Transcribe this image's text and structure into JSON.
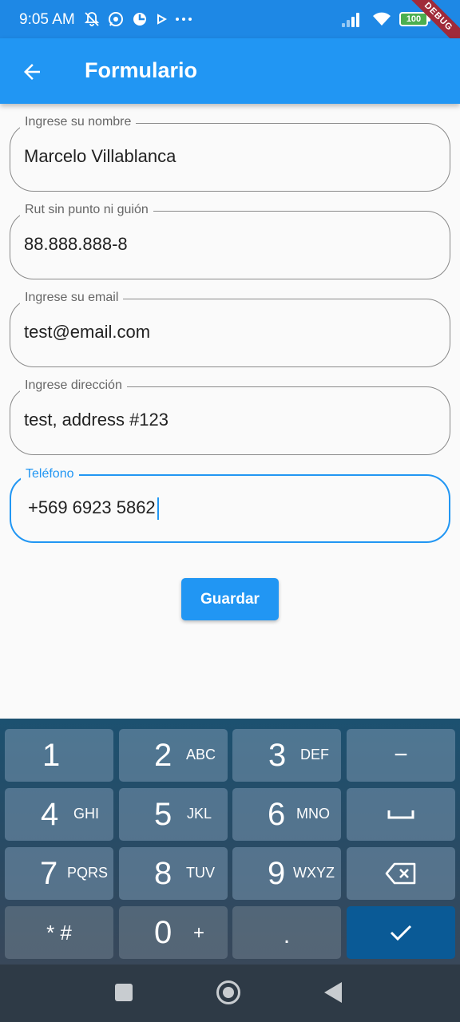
{
  "status_bar": {
    "time": "9:05 AM",
    "battery": "100",
    "debug_banner": "DEBUG",
    "left_icons": [
      "mute-icon",
      "whatsapp-icon",
      "app-icon",
      "play-icon",
      "more-icon"
    ],
    "right_icons": [
      "signal-icon",
      "wifi-icon",
      "battery-icon"
    ]
  },
  "app_bar": {
    "title": "Formulario",
    "back_icon": "arrow-back-icon"
  },
  "form": {
    "fields": [
      {
        "label": "Ingrese su nombre",
        "value": "Marcelo Villablanca"
      },
      {
        "label": "Rut sin punto ni guión",
        "value": "88.888.888-8"
      },
      {
        "label": "Ingrese su email",
        "value": "test@email.com"
      },
      {
        "label": "Ingrese dirección",
        "value": "test, address #123"
      },
      {
        "label": "Teléfono",
        "value": "+569 6923 5862"
      }
    ],
    "save_label": "Guardar"
  },
  "keyboard": {
    "rows": [
      [
        {
          "digit": "1",
          "letters": ""
        },
        {
          "digit": "2",
          "letters": "ABC"
        },
        {
          "digit": "3",
          "letters": "DEF"
        },
        {
          "symbol": "−"
        }
      ],
      [
        {
          "digit": "4",
          "letters": "GHI"
        },
        {
          "digit": "5",
          "letters": "JKL"
        },
        {
          "digit": "6",
          "letters": "MNO"
        },
        {
          "symbol": "space-icon"
        }
      ],
      [
        {
          "digit": "7",
          "letters": "PQRS"
        },
        {
          "digit": "8",
          "letters": "TUV"
        },
        {
          "digit": "9",
          "letters": "WXYZ"
        },
        {
          "symbol": "backspace-icon"
        }
      ],
      [
        {
          "symbol": "* #"
        },
        {
          "digit": "0",
          "letters": "+"
        },
        {
          "symbol": "."
        },
        {
          "symbol": "check-icon"
        }
      ]
    ]
  },
  "nav_bar": {
    "icons": [
      "recents-icon",
      "home-icon",
      "back-icon"
    ]
  },
  "colors": {
    "primary": "#2196f3",
    "status_bar": "#1e88e5",
    "keyboard_enter": "#0a5a96"
  }
}
